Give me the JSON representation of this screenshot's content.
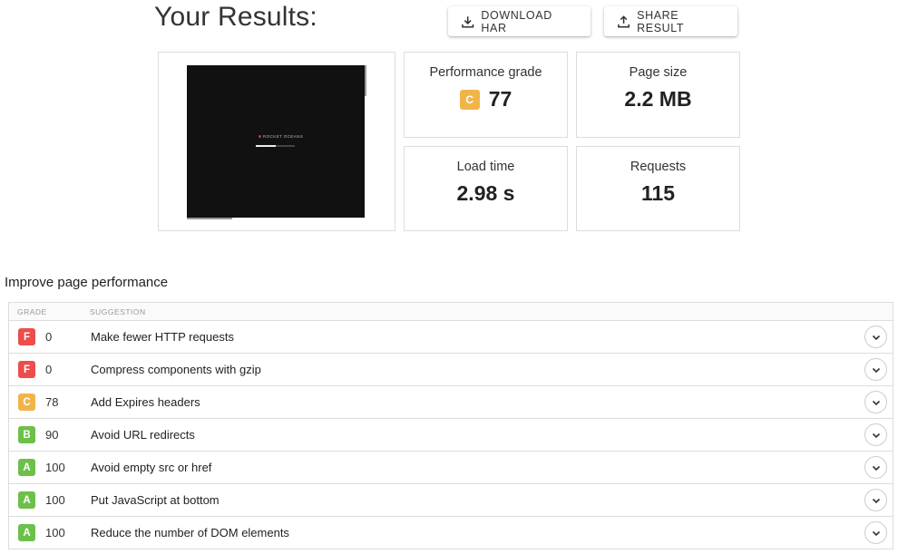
{
  "header": {
    "title": "Your Results:",
    "download_label": "DOWNLOAD HAR",
    "share_label": "SHARE RESULT"
  },
  "screenshot": {
    "logo_text": "ROCKET OCEANS",
    "loading_progress": 0.52
  },
  "metrics": {
    "performance": {
      "label": "Performance grade",
      "grade": "C",
      "value": "77"
    },
    "page_size": {
      "label": "Page size",
      "value": "2.2 MB"
    },
    "load_time": {
      "label": "Load time",
      "value": "2.98 s"
    },
    "requests": {
      "label": "Requests",
      "value": "115"
    }
  },
  "improve": {
    "title": "Improve page performance",
    "columns": {
      "grade": "GRADE",
      "suggestion": "SUGGESTION"
    },
    "rows": [
      {
        "grade": "F",
        "score": "0",
        "suggestion": "Make fewer HTTP requests"
      },
      {
        "grade": "F",
        "score": "0",
        "suggestion": "Compress components with gzip"
      },
      {
        "grade": "C",
        "score": "78",
        "suggestion": "Add Expires headers"
      },
      {
        "grade": "B",
        "score": "90",
        "suggestion": "Avoid URL redirects"
      },
      {
        "grade": "A",
        "score": "100",
        "suggestion": "Avoid empty src or href"
      },
      {
        "grade": "A",
        "score": "100",
        "suggestion": "Put JavaScript at bottom"
      },
      {
        "grade": "A",
        "score": "100",
        "suggestion": "Reduce the number of DOM elements"
      }
    ]
  },
  "colors": {
    "grade_A": "#6cc04a",
    "grade_B": "#6cc04a",
    "grade_C": "#f0b549",
    "grade_F": "#ec4d4d"
  }
}
